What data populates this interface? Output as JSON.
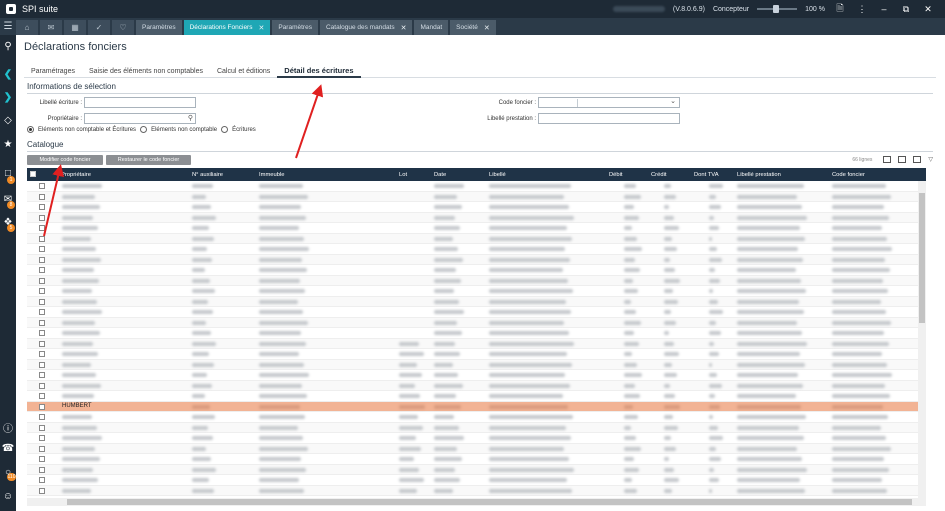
{
  "app": {
    "title": "SPI suite",
    "version": "(V.8.0.6.9)",
    "user_role": "Concepteur",
    "zoom": "100 %"
  },
  "tabs": [
    {
      "label": "Paramètres",
      "active": false,
      "closable": false
    },
    {
      "label": "Déclarations Fonciers",
      "active": true,
      "closable": true
    },
    {
      "label": "Paramètres",
      "active": false,
      "closable": false
    },
    {
      "label": "Catalogue des mandats",
      "active": false,
      "closable": true
    },
    {
      "label": "Mandat",
      "active": false,
      "closable": false
    },
    {
      "label": "Société",
      "active": false,
      "closable": true
    }
  ],
  "page": {
    "title": "Déclarations fonciers",
    "subtabs": [
      {
        "label": "Paramétrages",
        "active": false
      },
      {
        "label": "Saisie des éléments non comptables",
        "active": false
      },
      {
        "label": "Calcul et éditions",
        "active": false
      },
      {
        "label": "Détail des écritures",
        "active": true
      }
    ]
  },
  "selection": {
    "title": "Informations de sélection",
    "libelle_ecriture_label": "Libellé écriture :",
    "libelle_ecriture_value": "",
    "proprietaire_label": "Propriétaire :",
    "proprietaire_value": "",
    "code_foncier_label": "Code foncier :",
    "code_foncier_value": "",
    "libelle_prestation_label": "Libellé prestation :",
    "libelle_prestation_value": "",
    "radios": [
      {
        "label": "Eléments non comptable et Écritures",
        "checked": true
      },
      {
        "label": "Eléments non comptable",
        "checked": false
      },
      {
        "label": "Écritures",
        "checked": false
      }
    ]
  },
  "catalogue": {
    "title": "Catalogue",
    "modify_button": "Modifier code foncier",
    "restore_button": "Restaurer le code foncier",
    "row_count": "66 lignes",
    "columns": [
      "Propriétaire",
      "N° auxiliaire",
      "Immeuble",
      "Lot",
      "Date",
      "Libellé",
      "Débit",
      "Crédit",
      "Dont TVA",
      "Libellé prestation",
      "Code foncier"
    ],
    "highlight_row_name": "HUMBERT"
  },
  "rail_badges": [
    "1",
    "8",
    "5",
    "110"
  ],
  "colors": {
    "titlebar": "#1e2a36",
    "active_tab": "#1fa7b5",
    "table_header": "#1f3347",
    "highlight_row": "#f2b394",
    "arrow": "#e02020"
  }
}
